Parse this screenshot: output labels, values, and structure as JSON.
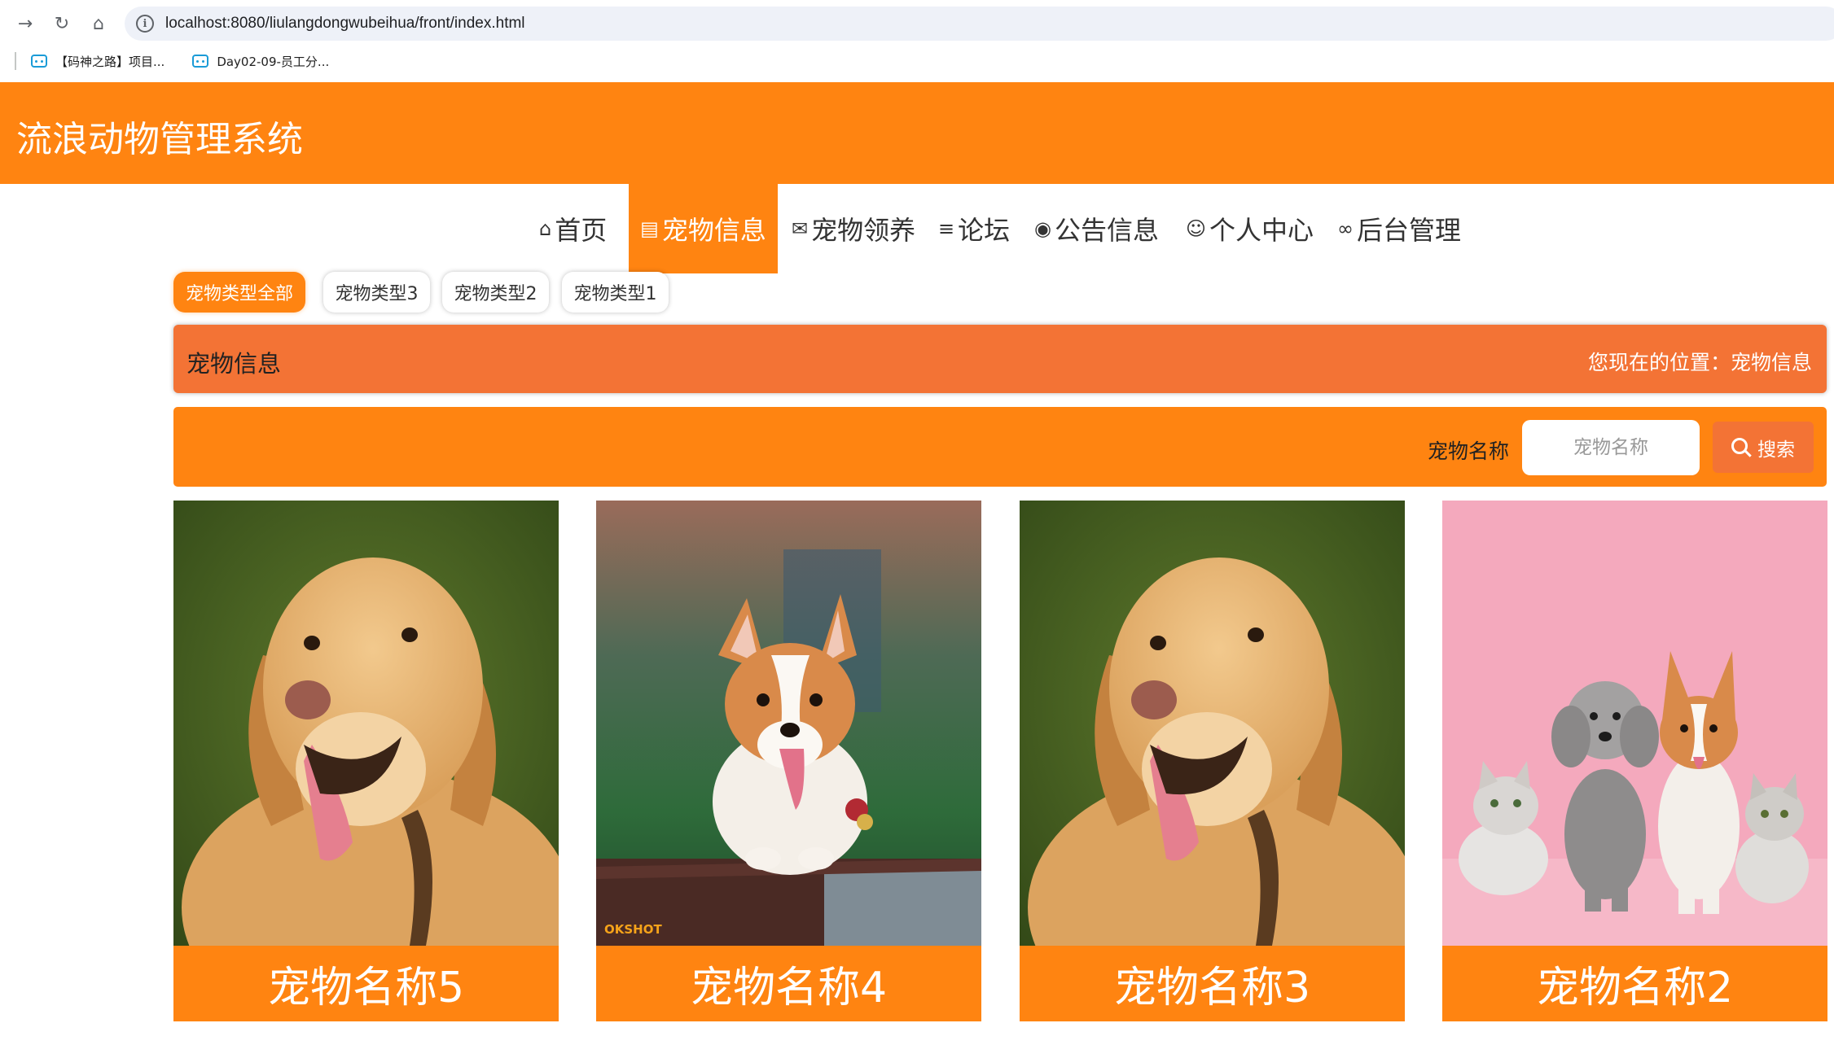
{
  "browser": {
    "url": "localhost:8080/liulangdongwubeihua/front/index.html",
    "bookmarks": [
      "【码神之路】项目...",
      "Day02-09-员工分..."
    ]
  },
  "app": {
    "title": "流浪动物管理系统",
    "accent_color": "#ff8411",
    "secondary_color": "#f37335"
  },
  "nav": {
    "items": [
      {
        "label": "首页",
        "icon": "home-icon"
      },
      {
        "label": "宠物信息",
        "icon": "gift-icon",
        "active": true
      },
      {
        "label": "宠物领养",
        "icon": "mail-icon"
      },
      {
        "label": "论坛",
        "icon": "sliders-icon"
      },
      {
        "label": "公告信息",
        "icon": "globe-icon"
      },
      {
        "label": "个人中心",
        "icon": "user-icon"
      },
      {
        "label": "后台管理",
        "icon": "link-icon"
      }
    ]
  },
  "filters": {
    "items": [
      {
        "label": "宠物类型全部",
        "active": true
      },
      {
        "label": "宠物类型3"
      },
      {
        "label": "宠物类型2"
      },
      {
        "label": "宠物类型1"
      }
    ]
  },
  "breadcrumb": {
    "title": "宠物信息",
    "location": "您现在的位置：宠物信息"
  },
  "search": {
    "label": "宠物名称",
    "placeholder": "宠物名称",
    "value": "",
    "button_label": "搜索"
  },
  "cards": [
    {
      "name": "宠物名称5",
      "image": "golden-retriever"
    },
    {
      "name": "宠物名称4",
      "image": "corgi",
      "watermark": "OKSHOT"
    },
    {
      "name": "宠物名称3",
      "image": "golden-retriever"
    },
    {
      "name": "宠物名称2",
      "image": "pets-group-pink"
    }
  ]
}
